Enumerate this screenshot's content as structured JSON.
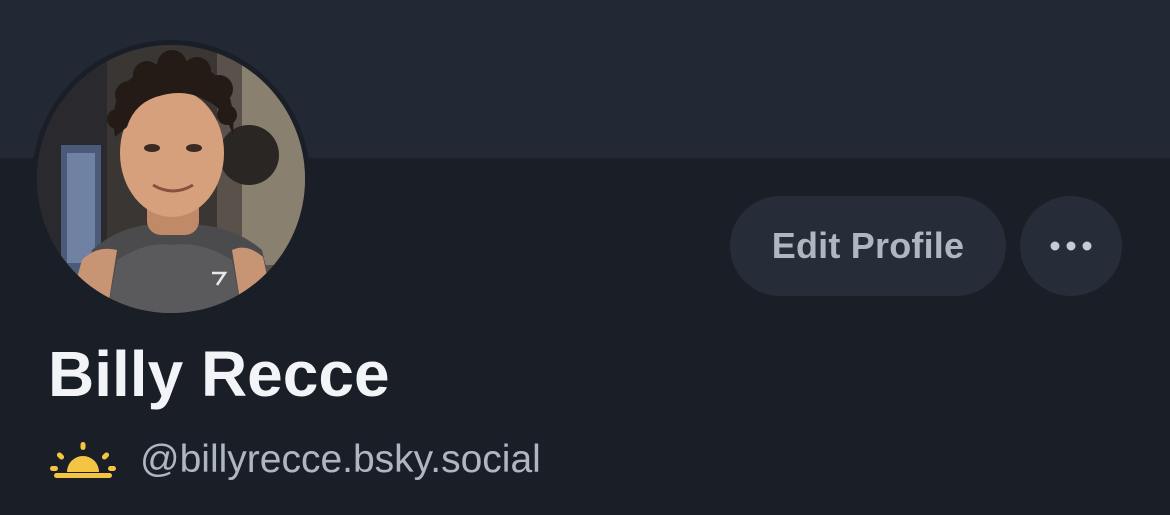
{
  "profile": {
    "display_name": "Billy Recce",
    "handle": "@billyrecce.bsky.social",
    "handle_prefix_icon": "sunrise-icon",
    "avatar_icon": "avatar-photo"
  },
  "actions": {
    "edit_profile_label": "Edit Profile",
    "more_icon": "more-horizontal-icon"
  },
  "colors": {
    "background": "#1a1f27",
    "banner": "#222834",
    "button_bg": "#262d39",
    "button_text": "#aeb6c2",
    "name_text": "#f2f4f7",
    "handle_text": "#aeb6c2",
    "sun_icon": "#f4c542"
  }
}
